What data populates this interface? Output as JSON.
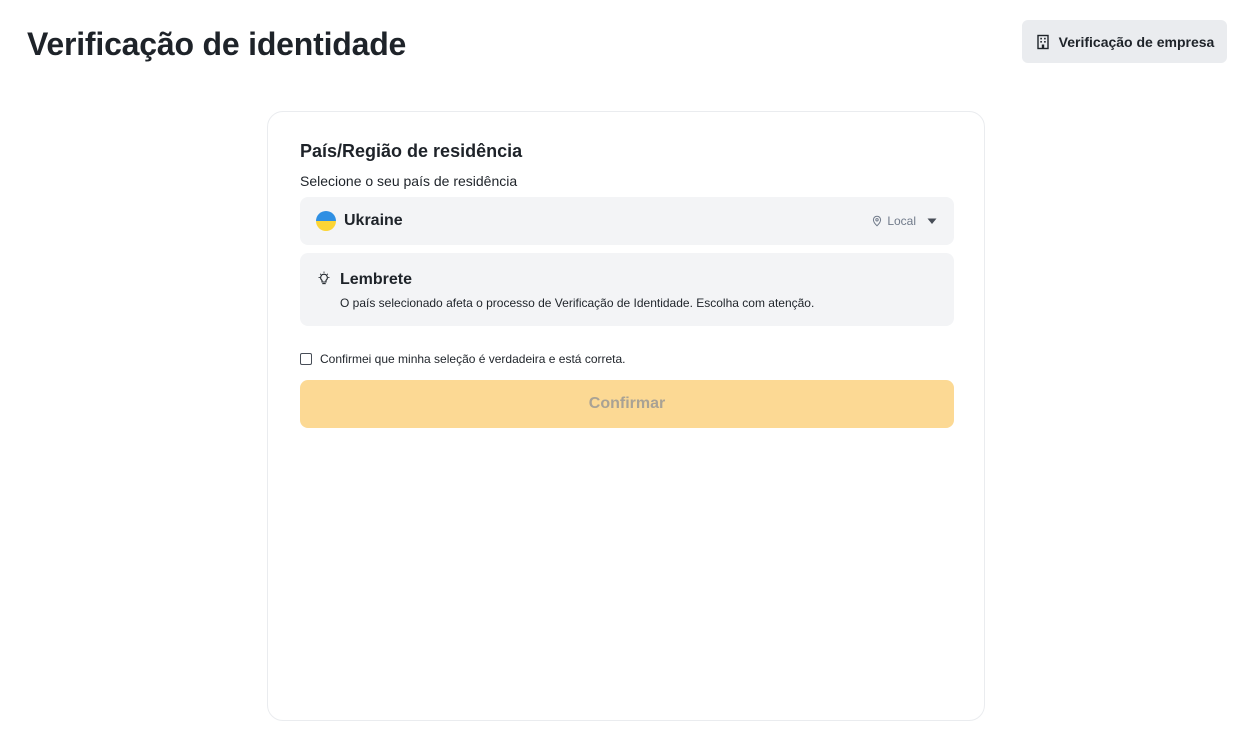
{
  "header": {
    "title": "Verificação de identidade",
    "business_button_label": "Verificação de empresa",
    "business_button_icon": "building-icon"
  },
  "card": {
    "section_title": "País/Região de residência",
    "section_subtitle": "Selecione o seu país de residência",
    "country_select": {
      "selected_country": "Ukraine",
      "flag_colors": [
        "#2f8fe3",
        "#fcd535"
      ],
      "location_hint": "Local",
      "location_icon": "map-pin-icon",
      "dropdown_icon": "caret-down-icon"
    },
    "reminder": {
      "icon": "lightbulb-icon",
      "title": "Lembrete",
      "text": "O país selecionado afeta o processo de Verificação de Identidade. Escolha com atenção."
    },
    "confirm_checkbox": {
      "label": "Confirmei que minha seleção é verdadeira e está correta.",
      "checked": false
    },
    "confirm_button": {
      "label": "Confirmar",
      "disabled": true
    }
  },
  "colors": {
    "accent_disabled": "#fcd994",
    "panel_bg": "#f3f4f6",
    "text_primary": "#1e2329",
    "text_secondary": "#707a8a"
  }
}
